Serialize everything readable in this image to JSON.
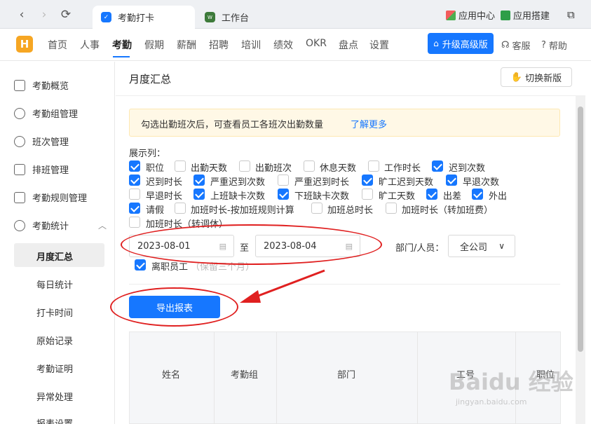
{
  "browser": {
    "tabs": [
      {
        "label": "考勤打卡",
        "icon": "shield-check-icon"
      },
      {
        "label": "工作台",
        "icon": "workbench-logo-icon"
      }
    ],
    "tools": {
      "app_center": "应用中心",
      "app_build": "应用搭建"
    }
  },
  "header": {
    "logo": "H",
    "menu": [
      "首页",
      "人事",
      "考勤",
      "假期",
      "薪酬",
      "招聘",
      "培训",
      "绩效",
      "OKR",
      "盘点",
      "设置"
    ],
    "active_menu": "考勤",
    "upgrade": "升级高级版",
    "service": "客服",
    "help": "帮助"
  },
  "sidebar": {
    "items": [
      "考勤概览",
      "考勤组管理",
      "班次管理",
      "排班管理",
      "考勤规则管理",
      "考勤统计"
    ],
    "sub_items": [
      "月度汇总",
      "每日统计",
      "打卡时间",
      "原始记录",
      "考勤证明",
      "异常处理",
      "报表设置"
    ],
    "active_sub": "月度汇总"
  },
  "page": {
    "title": "月度汇总",
    "switch_btn": "切换新版",
    "notice": "勾选出勤班次后，可查看员工各班次出勤数量",
    "learn_more": "了解更多",
    "display_cols_label": "展示列：",
    "columns": [
      {
        "label": "职位",
        "checked": true
      },
      {
        "label": "出勤天数",
        "checked": false
      },
      {
        "label": "出勤班次",
        "checked": false
      },
      {
        "label": "休息天数",
        "checked": false
      },
      {
        "label": "工作时长",
        "checked": false
      },
      {
        "label": "迟到次数",
        "checked": true
      },
      {
        "label": "迟到时长",
        "checked": true
      },
      {
        "label": "严重迟到次数",
        "checked": true
      },
      {
        "label": "严重迟到时长",
        "checked": false
      },
      {
        "label": "旷工迟到天数",
        "checked": true
      },
      {
        "label": "早退次数",
        "checked": true
      },
      {
        "label": "早退时长",
        "checked": false
      },
      {
        "label": "上班缺卡次数",
        "checked": true
      },
      {
        "label": "下班缺卡次数",
        "checked": true
      },
      {
        "label": "旷工天数",
        "checked": false
      },
      {
        "label": "出差",
        "checked": true
      },
      {
        "label": "外出",
        "checked": true
      },
      {
        "label": "请假",
        "checked": true
      },
      {
        "label": "加班时长-按加班规则计算",
        "checked": false
      },
      {
        "label": "加班总时长",
        "checked": false
      },
      {
        "label": "加班时长（转加班费）",
        "checked": false
      },
      {
        "label": "加班时长（转调休）",
        "checked": false
      }
    ],
    "date_start": "2023-08-01",
    "date_to": "至",
    "date_end": "2023-08-04",
    "dept_label": "部门/人员：",
    "dept_value": "全公司",
    "resigned_label": "离职员工",
    "resigned_hint": "（保留三个月）",
    "export_btn": "导出报表",
    "table_headers": [
      "姓名",
      "考勤组",
      "部门",
      "工号",
      "职位"
    ]
  },
  "watermark": {
    "brand": "Baidu 经验",
    "url": "jingyan.baidu.com"
  },
  "colors": {
    "primary": "#1677ff",
    "annotation": "#e02020",
    "notice_bg": "#fff8e6",
    "logo": "#f6a623"
  }
}
